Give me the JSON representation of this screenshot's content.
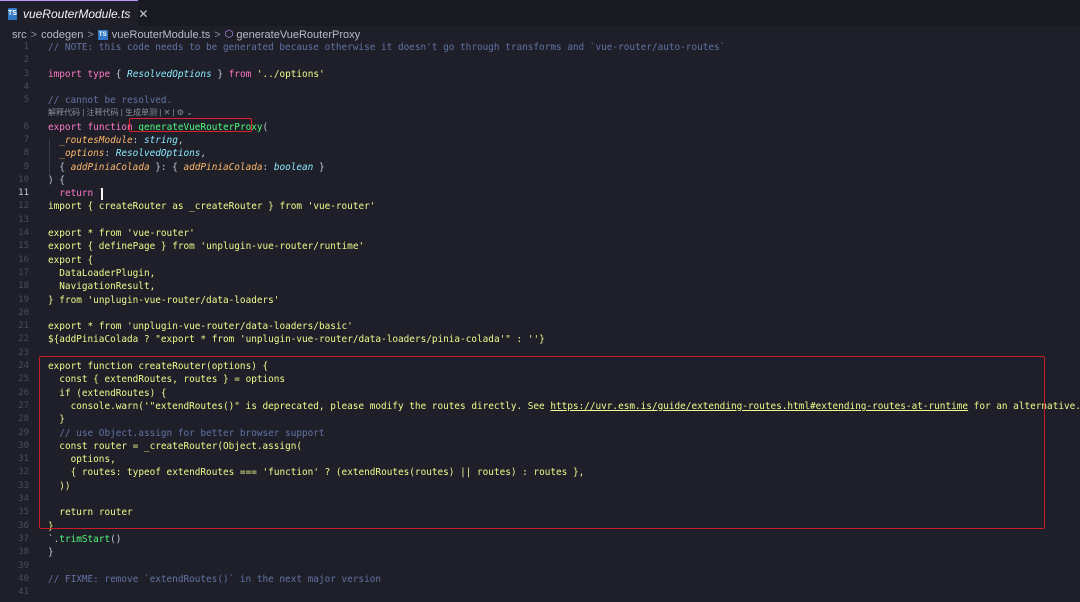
{
  "tab": {
    "title": "vueRouterModule.ts",
    "close": "✕",
    "badge": "TS"
  },
  "breadcrumb": {
    "root": "src",
    "folder": "codegen",
    "file": "vueRouterModule.ts",
    "symbol": "generateVueRouterProxy",
    "sep": ">"
  },
  "codelens": "解释代码 | 注释代码 | 生成单测 | ✕ | ⚙ ⌄",
  "lines": [
    {
      "n": "1",
      "code": "// NOTE: this code needs to be generated because otherwise it doesn't go through transforms and `vue-router/auto-routes`"
    },
    {
      "n": "2",
      "code": ""
    },
    {
      "n": "3",
      "code": "import type { ResolvedOptions } from '../options'"
    },
    {
      "n": "4",
      "code": ""
    },
    {
      "n": "5",
      "code": "// cannot be resolved."
    },
    {
      "n": "6",
      "code": "export function generateVueRouterProxy("
    },
    {
      "n": "7",
      "code": "  _routesModule: string,"
    },
    {
      "n": "8",
      "code": "  _options: ResolvedOptions,"
    },
    {
      "n": "9",
      "code": "  { addPiniaColada }: { addPiniaColada: boolean }"
    },
    {
      "n": "10",
      "code": ") {"
    },
    {
      "n": "11",
      "code": "  return `"
    },
    {
      "n": "12",
      "code": "import { createRouter as _createRouter } from 'vue-router'"
    },
    {
      "n": "13",
      "code": ""
    },
    {
      "n": "14",
      "code": "export * from 'vue-router'"
    },
    {
      "n": "15",
      "code": "export { definePage } from 'unplugin-vue-router/runtime'"
    },
    {
      "n": "16",
      "code": "export {"
    },
    {
      "n": "17",
      "code": "  DataLoaderPlugin,"
    },
    {
      "n": "18",
      "code": "  NavigationResult,"
    },
    {
      "n": "19",
      "code": "} from 'unplugin-vue-router/data-loaders'"
    },
    {
      "n": "20",
      "code": ""
    },
    {
      "n": "21",
      "code": "export * from 'unplugin-vue-router/data-loaders/basic'"
    },
    {
      "n": "22",
      "code": "${addPiniaColada ? \"export * from 'unplugin-vue-router/data-loaders/pinia-colada'\" : ''}"
    },
    {
      "n": "23",
      "code": ""
    },
    {
      "n": "24",
      "code": "export function createRouter(options) {"
    },
    {
      "n": "25",
      "code": "  const { extendRoutes, routes } = options"
    },
    {
      "n": "26",
      "code": "  if (extendRoutes) {"
    },
    {
      "n": "27",
      "code": "    console.warn('\"extendRoutes()\" is deprecated, please modify the routes directly. See https://uvr.esm.is/guide/extending-routes.html#extending-routes-at-runtime for an alternative.')"
    },
    {
      "n": "28",
      "code": "  }"
    },
    {
      "n": "29",
      "code": "  // use Object.assign for better browser support"
    },
    {
      "n": "30",
      "code": "  const router = _createRouter(Object.assign("
    },
    {
      "n": "31",
      "code": "    options,"
    },
    {
      "n": "32",
      "code": "    { routes: typeof extendRoutes === 'function' ? (extendRoutes(routes) || routes) : routes },"
    },
    {
      "n": "33",
      "code": "  ))"
    },
    {
      "n": "34",
      "code": ""
    },
    {
      "n": "35",
      "code": "  return router"
    },
    {
      "n": "36",
      "code": "}"
    },
    {
      "n": "37",
      "code": "`.trimStart()"
    },
    {
      "n": "38",
      "code": "}"
    },
    {
      "n": "39",
      "code": ""
    },
    {
      "n": "40",
      "code": "// FIXME: remove `extendRoutes()` in the next major version"
    },
    {
      "n": "41",
      "code": ""
    }
  ],
  "active_line": "11",
  "colors": {
    "background": "#1e1f29",
    "comment": "#6272a4",
    "keyword": "#ff79c6",
    "string": "#f1fa8c",
    "function": "#50fa7b",
    "type": "#8be9fd",
    "param": "#ffb86c",
    "highlight_box": "#e0202a"
  }
}
